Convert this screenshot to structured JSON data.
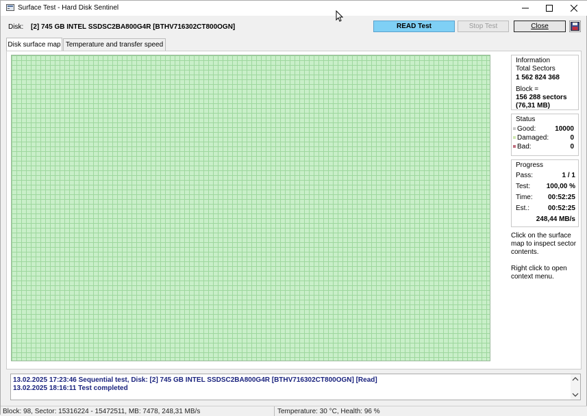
{
  "window": {
    "title": "Surface Test - Hard Disk Sentinel",
    "minimize_icon": "minimize-icon",
    "maximize_icon": "maximize-icon",
    "close_icon": "close-icon"
  },
  "disk": {
    "label": "Disk:",
    "value": "[2] 745 GB  INTEL SSDSC2BA800G4R [BTHV716302CT800OGN]"
  },
  "toolbar": {
    "read_test": "READ Test",
    "stop_test": "Stop Test",
    "close": "Close",
    "save_icon": "save-icon"
  },
  "tabs": [
    {
      "label": "Disk surface map",
      "active": true
    },
    {
      "label": "Temperature and transfer speed",
      "active": false
    }
  ],
  "information": {
    "title": "Information",
    "total_sectors_label": "Total Sectors",
    "total_sectors_value": "1 562 824 368",
    "block_label": "Block =",
    "block_sectors": "156 288 sectors",
    "block_mb": "(76,31 MB)"
  },
  "status": {
    "title": "Status",
    "good_label": "Good:",
    "good_value": "10000",
    "damaged_label": "Damaged:",
    "damaged_value": "0",
    "bad_label": "Bad:",
    "bad_value": "0",
    "good_color": "#c8c8c8",
    "damaged_color": "#cfe8b0",
    "bad_color": "#c07080"
  },
  "progress": {
    "title": "Progress",
    "pass_label": "Pass:",
    "pass_value": "1 / 1",
    "test_label": "Test:",
    "test_value": "100,00 %",
    "time_label": "Time:",
    "time_value": "00:52:25",
    "est_label": "Est.:",
    "est_value": "00:52:25",
    "speed_value": "248,44 MB/s"
  },
  "hints": {
    "hint1_line1": "Click on the surface",
    "hint1_line2": "map to inspect sector",
    "hint1_line3": "contents.",
    "hint2_line1": "Right click to open",
    "hint2_line2": "context menu."
  },
  "log": {
    "lines": [
      "13.02.2025  17:23:46   Sequential test, Disk: [2] 745 GB  INTEL SSDSC2BA800G4R [BTHV716302CT800OGN] [Read]",
      "13.02.2025  18:16:11   Test completed"
    ]
  },
  "statusbar": {
    "block_info": "Block: 98, Sector: 15316224 - 15472511, MB: 7478, 248,31 MB/s",
    "health_info": "Temperature: 30  °C,  Health: 96 %"
  },
  "colors": {
    "surface_fill": "#c9efc9",
    "surface_grid": "#9ed79e",
    "read_button": "#7fd0f5",
    "log_text": "#1a237e"
  }
}
